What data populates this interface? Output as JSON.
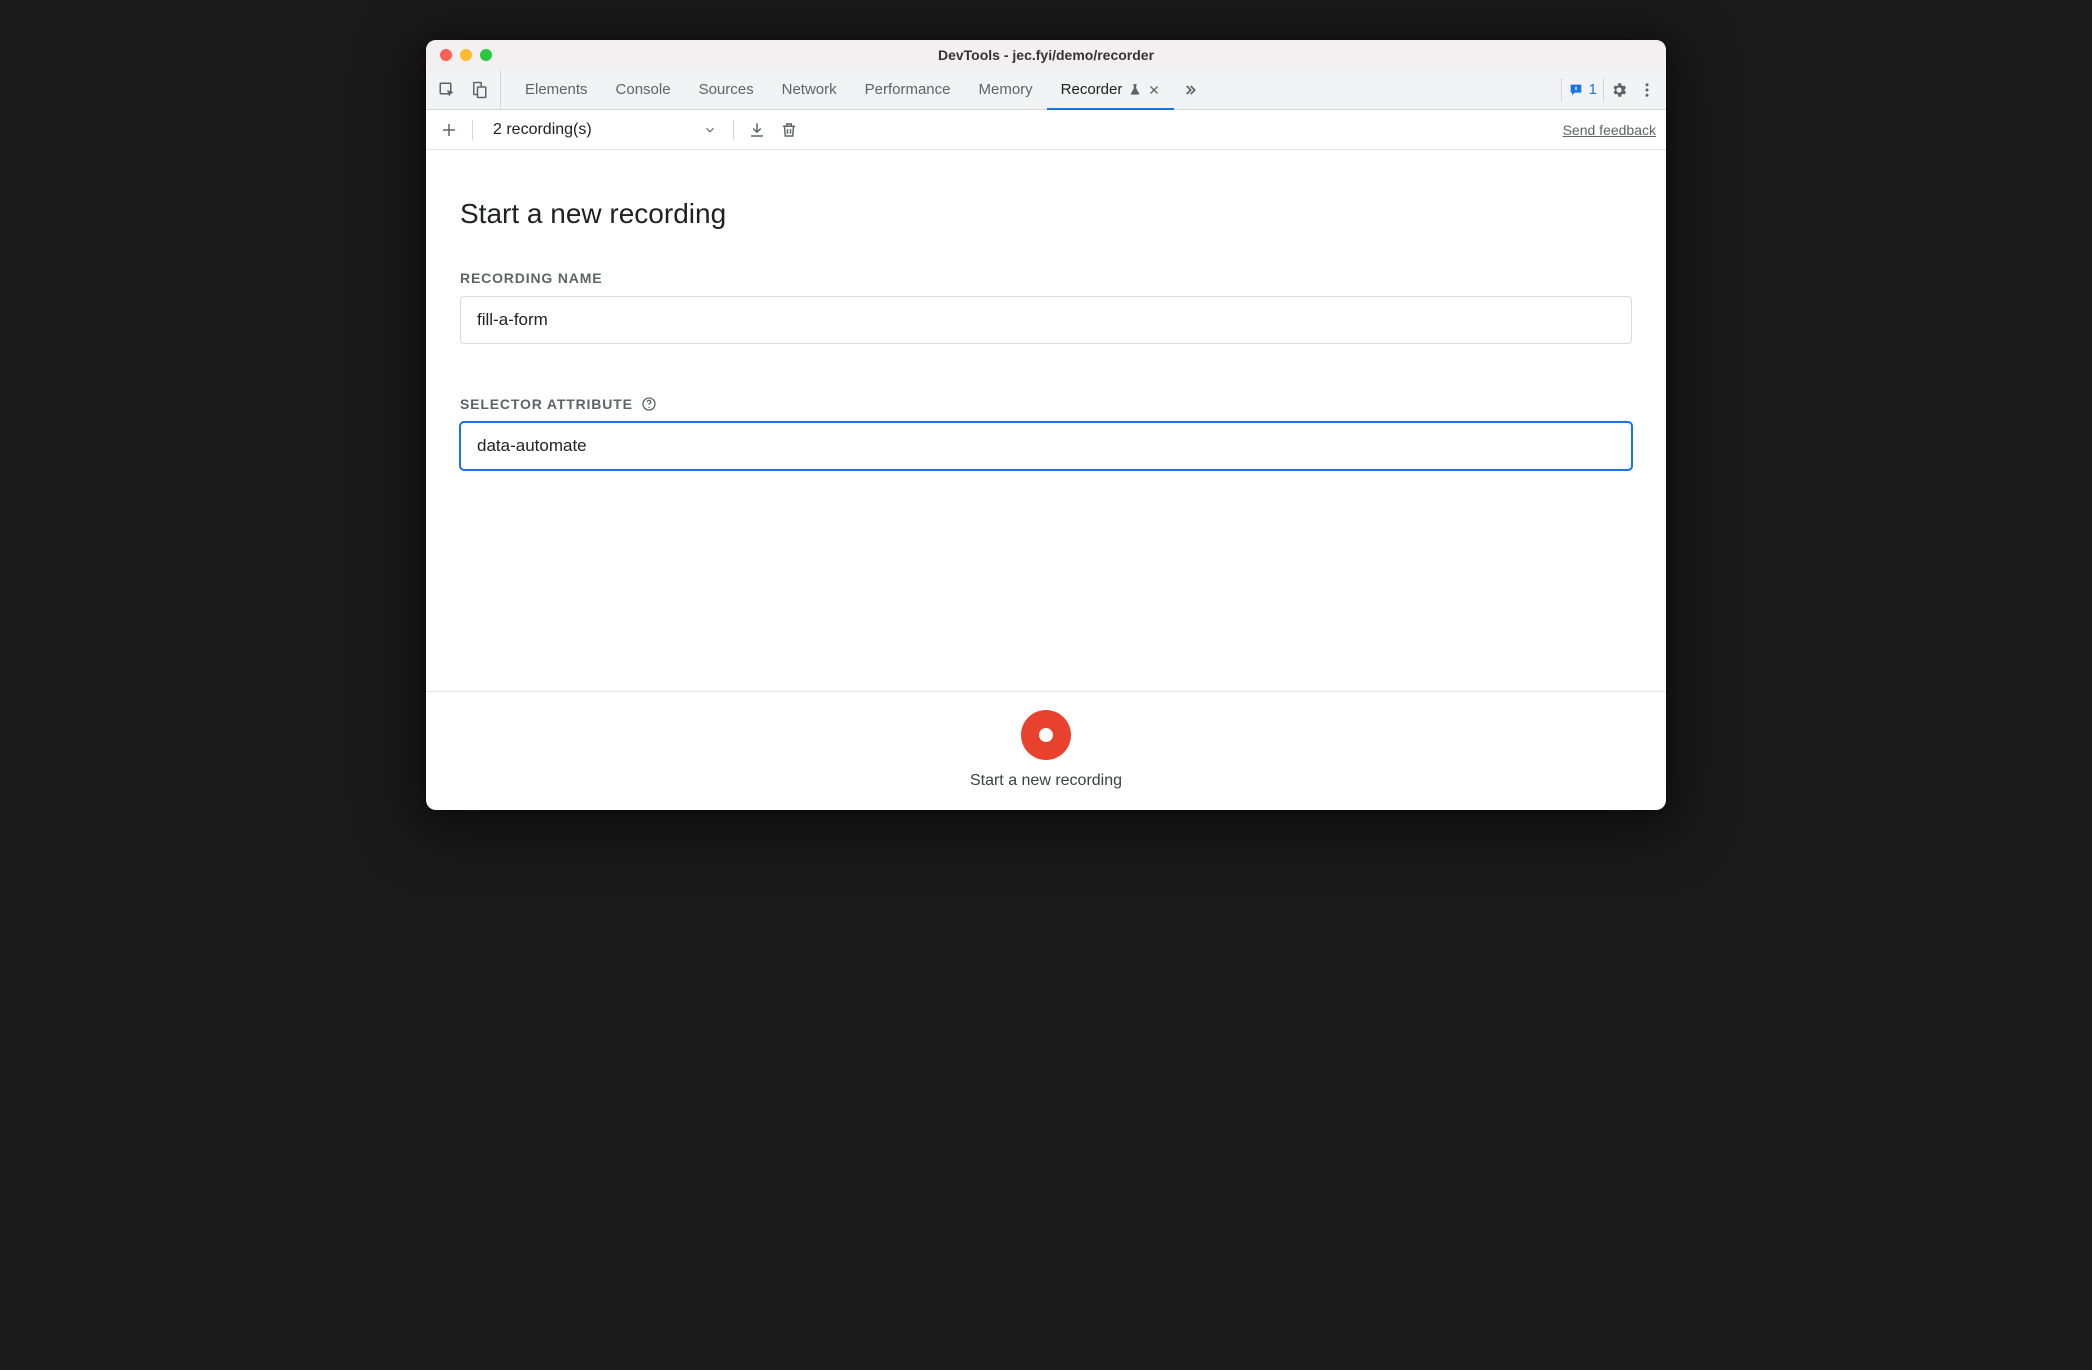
{
  "window": {
    "title": "DevTools - jec.fyi/demo/recorder"
  },
  "tabs": {
    "items": [
      {
        "label": "Elements",
        "active": false
      },
      {
        "label": "Console",
        "active": false
      },
      {
        "label": "Sources",
        "active": false
      },
      {
        "label": "Network",
        "active": false
      },
      {
        "label": "Performance",
        "active": false
      },
      {
        "label": "Memory",
        "active": false
      },
      {
        "label": "Recorder",
        "active": true,
        "experiment": true,
        "closeable": true
      }
    ],
    "issues_count": "1"
  },
  "toolbar": {
    "recording_selector": "2 recording(s)",
    "feedback_link": "Send feedback"
  },
  "main": {
    "heading": "Start a new recording",
    "recording_name_label": "RECORDING NAME",
    "recording_name_value": "fill-a-form",
    "selector_attribute_label": "SELECTOR ATTRIBUTE",
    "selector_attribute_value": "data-automate"
  },
  "footer": {
    "start_label": "Start a new recording"
  }
}
